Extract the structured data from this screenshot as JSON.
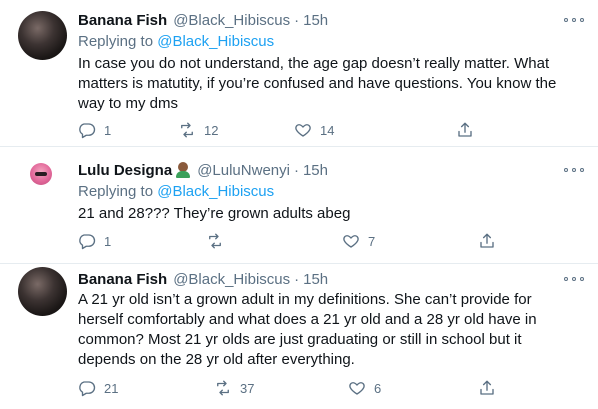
{
  "tweets": [
    {
      "name": "Banana Fish",
      "handle": "@Black_Hibiscus",
      "dot": "·",
      "time": "15h",
      "reply_prefix": "Replying to",
      "reply_to": "@Black_Hibiscus",
      "text": "In case you do not understand, the age gap doesn’t really matter. What matters is matutity, if you’re confused and have questions. You know the way to my dms",
      "reply_count": "1",
      "retweet_count": "12",
      "like_count": "14"
    },
    {
      "name": "Lulu Designa",
      "handle": "@LuluNwenyi",
      "dot": "·",
      "time": "15h",
      "reply_prefix": "Replying to",
      "reply_to": "@Black_Hibiscus",
      "text": "21 and 28??? They’re grown adults abeg",
      "reply_count": "1",
      "retweet_count": "",
      "like_count": "7"
    },
    {
      "name": "Banana Fish",
      "handle": "@Black_Hibiscus",
      "dot": "·",
      "time": "15h",
      "text": "A 21 yr old isn’t a grown adult in my definitions. She can’t provide for herself comfortably and what does a 21 yr old and a 28 yr old have in common? Most 21 yr olds are just graduating or still in school but it depends on the 28 yr old after everything.",
      "reply_count": "21",
      "retweet_count": "37",
      "like_count": "6"
    }
  ],
  "icons": {
    "reply": "reply-icon",
    "retweet": "retweet-icon",
    "like": "heart-icon",
    "share": "share-icon",
    "more": "more-options-icon"
  },
  "colors": {
    "text": "#0f1419",
    "muted": "#5b7083",
    "link": "#1da1f2",
    "divider": "#e6ecf0"
  }
}
